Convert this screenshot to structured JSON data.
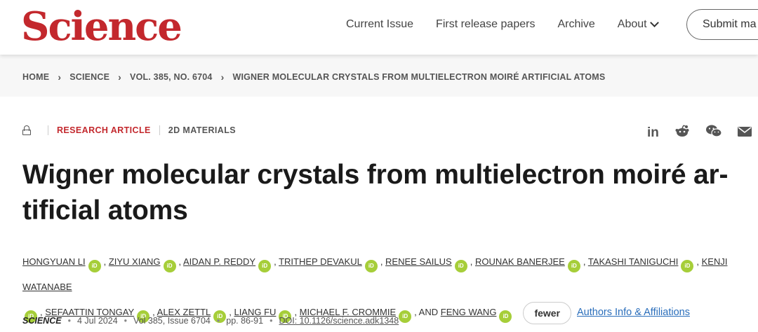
{
  "header": {
    "logo": "Science",
    "nav": [
      "Current Issue",
      "First release papers",
      "Archive",
      "About"
    ],
    "submit_label": "Submit ma"
  },
  "breadcrumb": [
    "HOME",
    "SCIENCE",
    "VOL. 385, NO. 6704",
    "WIGNER MOLECULAR CRYSTALS FROM MULTIELECTRON MOIRÉ ARTIFICIAL ATOMS"
  ],
  "article": {
    "type": "RESEARCH ARTICLE",
    "subject": "2D MATERIALS",
    "title": "Wigner molecular crystals from multielectron moiré ar-tificial atoms",
    "title_line1": "Wigner molecular crystals from multielectron moiré ar-",
    "title_line2": "tificial atoms",
    "authors": [
      "HONGYUAN LI",
      "ZIYU XIANG",
      "AIDAN P. REDDY",
      "TRITHEP DEVAKUL",
      "RENEE SAILUS",
      "ROUNAK BANERJEE",
      "TAKASHI TANIGUCHI",
      "KENJI WATANABE",
      "SEFAATTIN TONGAY",
      "ALEX ZETTL",
      "LIANG FU",
      "MICHAEL F. CROMMIE",
      "FENG WANG"
    ],
    "and_label": ", AND",
    "orcid_label": "iD",
    "fewer_label": "fewer",
    "affiliations_label": "Authors Info & Affiliations"
  },
  "citation": {
    "journal": "SCIENCE",
    "date": "4 Jul 2024",
    "volume": "Vol 385, Issue 6704",
    "pages": "pp. 86-91",
    "doi": "DOI: 10.1126/science.adk1348"
  },
  "share_icons": [
    "linkedin-icon",
    "reddit-icon",
    "wechat-icon",
    "email-icon"
  ],
  "colors": {
    "brand_red": "#c3282d",
    "orcid_green": "#a6ce39",
    "link_blue": "#2a6ebb"
  }
}
